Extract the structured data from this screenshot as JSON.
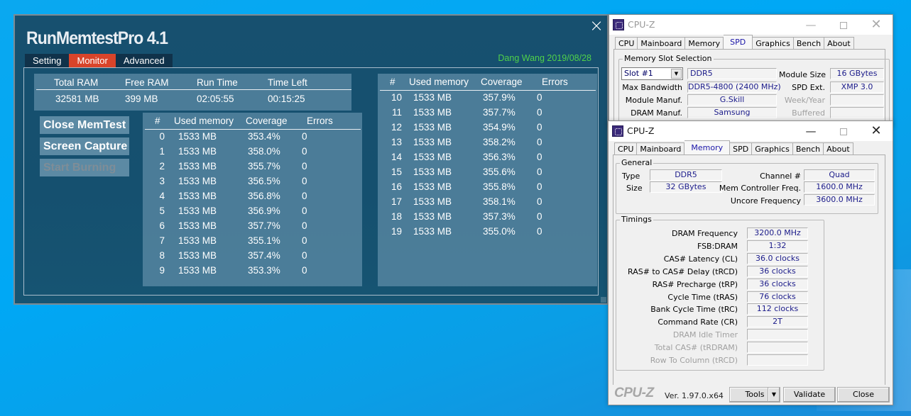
{
  "runmemtest": {
    "title": "RunMemtestPro 4.1",
    "close_icon": "×",
    "tabs": [
      {
        "label": "Setting",
        "active": false
      },
      {
        "label": "Monitor",
        "active": true
      },
      {
        "label": "Advanced",
        "active": false
      }
    ],
    "author": "Dang Wang 2019/08/28",
    "stats": {
      "headers": [
        "Total RAM",
        "Free RAM",
        "Run Time",
        "Time Left"
      ],
      "values": [
        "32581 MB",
        "399 MB",
        "02:05:55",
        "00:15:25"
      ]
    },
    "buttons": {
      "close_memtest": "Close MemTest",
      "screen_capture": "Screen Capture",
      "start_burning": "Start Burning"
    },
    "table_headers": [
      "#",
      "Used memory",
      "Coverage",
      "Errors"
    ],
    "rows": [
      {
        "n": "0",
        "used": "1533 MB",
        "coverage": "353.4%",
        "errors": "0"
      },
      {
        "n": "1",
        "used": "1533 MB",
        "coverage": "358.0%",
        "errors": "0"
      },
      {
        "n": "2",
        "used": "1533 MB",
        "coverage": "355.7%",
        "errors": "0"
      },
      {
        "n": "3",
        "used": "1533 MB",
        "coverage": "356.5%",
        "errors": "0"
      },
      {
        "n": "4",
        "used": "1533 MB",
        "coverage": "356.8%",
        "errors": "0"
      },
      {
        "n": "5",
        "used": "1533 MB",
        "coverage": "356.9%",
        "errors": "0"
      },
      {
        "n": "6",
        "used": "1533 MB",
        "coverage": "357.7%",
        "errors": "0"
      },
      {
        "n": "7",
        "used": "1533 MB",
        "coverage": "355.1%",
        "errors": "0"
      },
      {
        "n": "8",
        "used": "1533 MB",
        "coverage": "357.4%",
        "errors": "0"
      },
      {
        "n": "9",
        "used": "1533 MB",
        "coverage": "353.3%",
        "errors": "0"
      },
      {
        "n": "10",
        "used": "1533 MB",
        "coverage": "357.9%",
        "errors": "0"
      },
      {
        "n": "11",
        "used": "1533 MB",
        "coverage": "357.7%",
        "errors": "0"
      },
      {
        "n": "12",
        "used": "1533 MB",
        "coverage": "354.9%",
        "errors": "0"
      },
      {
        "n": "13",
        "used": "1533 MB",
        "coverage": "358.2%",
        "errors": "0"
      },
      {
        "n": "14",
        "used": "1533 MB",
        "coverage": "356.3%",
        "errors": "0"
      },
      {
        "n": "15",
        "used": "1533 MB",
        "coverage": "355.6%",
        "errors": "0"
      },
      {
        "n": "16",
        "used": "1533 MB",
        "coverage": "355.8%",
        "errors": "0"
      },
      {
        "n": "17",
        "used": "1533 MB",
        "coverage": "358.1%",
        "errors": "0"
      },
      {
        "n": "18",
        "used": "1533 MB",
        "coverage": "357.3%",
        "errors": "0"
      },
      {
        "n": "19",
        "used": "1533 MB",
        "coverage": "355.0%",
        "errors": "0"
      }
    ]
  },
  "cpuz_tabs": [
    "CPU",
    "Mainboard",
    "Memory",
    "SPD",
    "Graphics",
    "Bench",
    "About"
  ],
  "cpuz_spd": {
    "title": "CPU-Z",
    "active_tab": "SPD",
    "group_label": "Memory Slot Selection",
    "slot_selected": "Slot #1",
    "memory_type": "DDR5",
    "fields": {
      "max_bandwidth_label": "Max Bandwidth",
      "max_bandwidth": "DDR5-4800 (2400 MHz)",
      "module_manuf_label": "Module Manuf.",
      "module_manuf": "G.Skill",
      "dram_manuf_label": "DRAM Manuf.",
      "dram_manuf": "Samsung",
      "module_size_label": "Module Size",
      "module_size": "16 GBytes",
      "spd_ext_label": "SPD Ext.",
      "spd_ext": "XMP 3.0",
      "week_year_label": "Week/Year",
      "buffered_label": "Buffered"
    }
  },
  "cpuz_memory": {
    "title": "CPU-Z",
    "active_tab": "Memory",
    "general": {
      "label": "General",
      "type_label": "Type",
      "type": "DDR5",
      "size_label": "Size",
      "size": "32 GBytes",
      "channel_label": "Channel #",
      "channel": "Quad",
      "mem_ctrl_label": "Mem Controller Freq.",
      "mem_ctrl": "1600.0 MHz",
      "uncore_label": "Uncore Frequency",
      "uncore": "3600.0 MHz"
    },
    "timings": {
      "label": "Timings",
      "rows": [
        {
          "label": "DRAM Frequency",
          "value": "3200.0 MHz",
          "dim": false
        },
        {
          "label": "FSB:DRAM",
          "value": "1:32",
          "dim": false
        },
        {
          "label": "CAS# Latency (CL)",
          "value": "36.0 clocks",
          "dim": false
        },
        {
          "label": "RAS# to CAS# Delay (tRCD)",
          "value": "36 clocks",
          "dim": false
        },
        {
          "label": "RAS# Precharge (tRP)",
          "value": "36 clocks",
          "dim": false
        },
        {
          "label": "Cycle Time (tRAS)",
          "value": "76 clocks",
          "dim": false
        },
        {
          "label": "Bank Cycle Time (tRC)",
          "value": "112 clocks",
          "dim": false
        },
        {
          "label": "Command Rate (CR)",
          "value": "2T",
          "dim": false
        },
        {
          "label": "DRAM Idle Timer",
          "value": "",
          "dim": true
        },
        {
          "label": "Total CAS# (tRDRAM)",
          "value": "",
          "dim": true
        },
        {
          "label": "Row To Column (tRCD)",
          "value": "",
          "dim": true
        }
      ]
    },
    "footer": {
      "logo": "CPU-Z",
      "version": "Ver. 1.97.0.x64",
      "tools": "Tools",
      "validate": "Validate",
      "close": "Close"
    }
  }
}
